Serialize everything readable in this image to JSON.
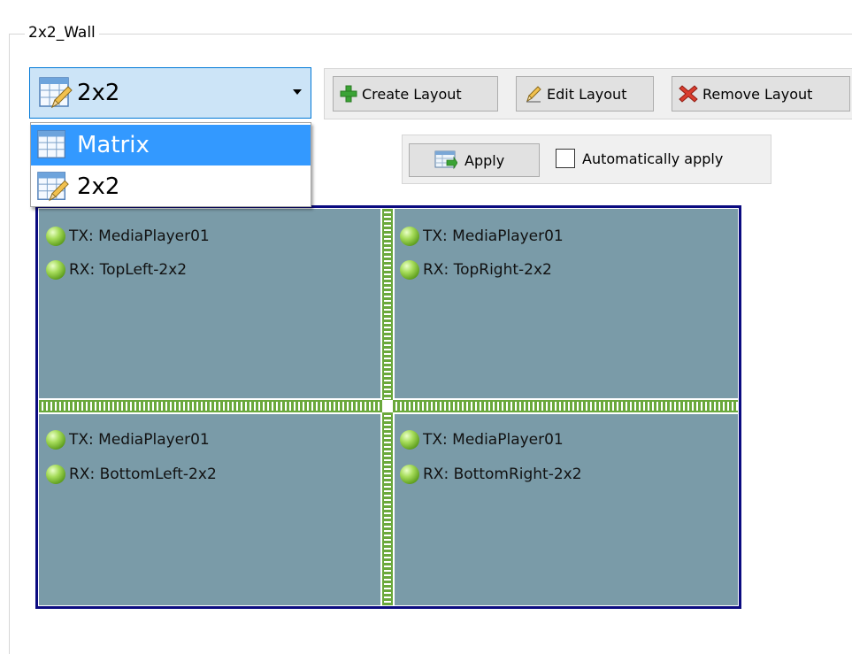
{
  "group": {
    "title": "2x2_Wall"
  },
  "combo": {
    "value": "2x2",
    "icon": "layout-edit-icon"
  },
  "dropdown": {
    "items": [
      {
        "label": "Matrix",
        "icon": "layout-edit-icon",
        "selected": true
      },
      {
        "label": "2x2",
        "icon": "layout-edit-icon",
        "selected": false
      }
    ]
  },
  "toolbar": {
    "create_label": "Create Layout",
    "edit_label": "Edit Layout",
    "remove_label": "Remove Layout",
    "icons": {
      "create": "plus-icon",
      "edit": "pencil-icon",
      "remove": "x-icon"
    },
    "colors": {
      "create": "#3aa335",
      "remove": "#d93d2e"
    }
  },
  "apply": {
    "label": "Apply",
    "auto_label": "Automatically apply",
    "auto_checked": false
  },
  "wall": {
    "border_color": "#0b0b80",
    "cell_color": "#7a9ba8",
    "divider_color": "#6aa83b",
    "cells": [
      {
        "tx": "TX: MediaPlayer01",
        "rx": "RX: TopLeft-2x2"
      },
      {
        "tx": "TX: MediaPlayer01",
        "rx": "RX: TopRight-2x2"
      },
      {
        "tx": "TX: MediaPlayer01",
        "rx": "RX: BottomLeft-2x2"
      },
      {
        "tx": "TX: MediaPlayer01",
        "rx": "RX: BottomRight-2x2"
      }
    ]
  }
}
